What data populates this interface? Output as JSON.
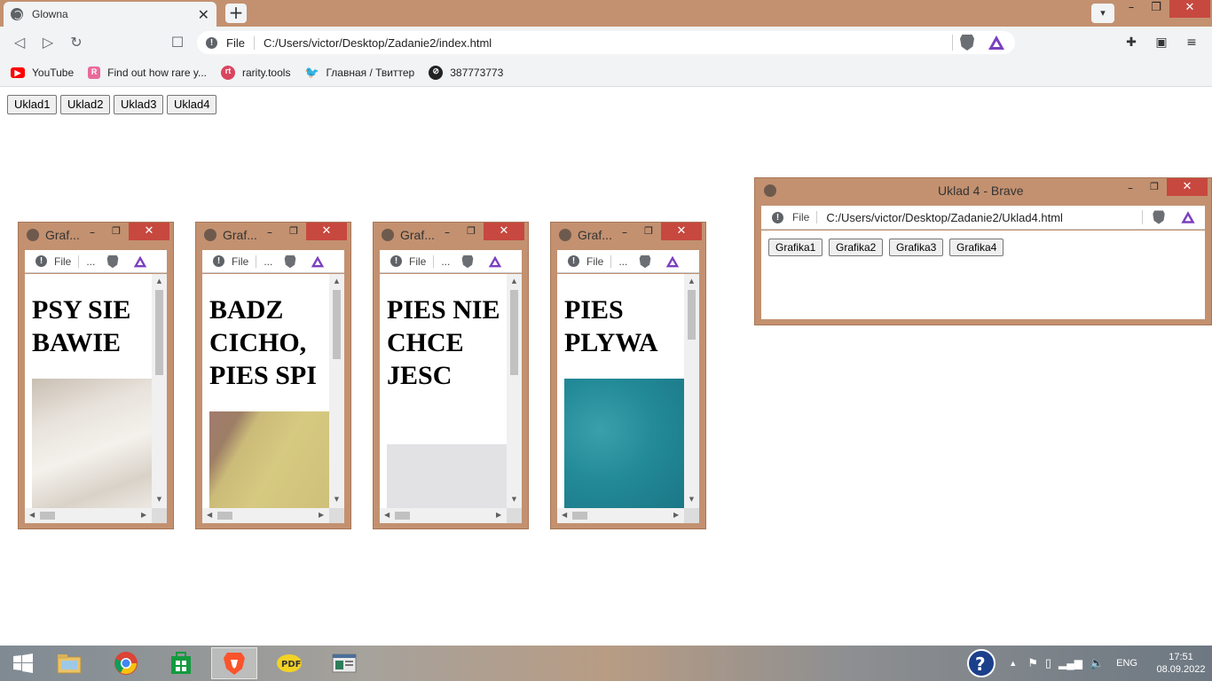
{
  "browser": {
    "tab_title": "Glowna",
    "new_tab": "+",
    "tab_close": "✕",
    "address_scheme": "File",
    "address_url": "C:/Users/victor/Desktop/Zadanie2/index.html",
    "window_controls": {
      "minimize": "–",
      "maximize": "❐",
      "close": "✕"
    }
  },
  "bookmarks": [
    {
      "label": "YouTube",
      "icon": "youtube-icon",
      "color": "#ff0000"
    },
    {
      "label": "Find out how rare y...",
      "icon": "rarity-icon",
      "color": "#e86a9a"
    },
    {
      "label": "rarity.tools",
      "icon": "rt-icon",
      "color": "#d9455f"
    },
    {
      "label": "Главная / Твиттер",
      "icon": "twitter-icon",
      "color": "#1da1f2"
    },
    {
      "label": "387773773",
      "icon": "nft-icon",
      "color": "#222222"
    }
  ],
  "page": {
    "buttons": [
      "Uklad1",
      "Uklad2",
      "Uklad3",
      "Uklad4"
    ]
  },
  "popups": [
    {
      "title": "Graf...",
      "heading": "PSY SIE BAWIE",
      "address_scheme": "File",
      "address_more": "..."
    },
    {
      "title": "Graf...",
      "heading": "BADZ CICHO, PIES SPI",
      "address_scheme": "File",
      "address_more": "..."
    },
    {
      "title": "Graf...",
      "heading": "PIES NIE CHCE JESC",
      "address_scheme": "File",
      "address_more": "..."
    },
    {
      "title": "Graf...",
      "heading": "PIES PLYWA",
      "address_scheme": "File",
      "address_more": "..."
    }
  ],
  "uklad_window": {
    "title": "Uklad 4 - Brave",
    "address_scheme": "File",
    "address_url": "C:/Users/victor/Desktop/Zadanie2/Uklad4.html",
    "buttons": [
      "Grafika1",
      "Grafika2",
      "Grafika3",
      "Grafika4"
    ]
  },
  "taskbar": {
    "language": "ENG",
    "time": "17:51",
    "date": "08.09.2022"
  },
  "colors": {
    "accent": "#c39170",
    "close_red": "#c7483f"
  }
}
